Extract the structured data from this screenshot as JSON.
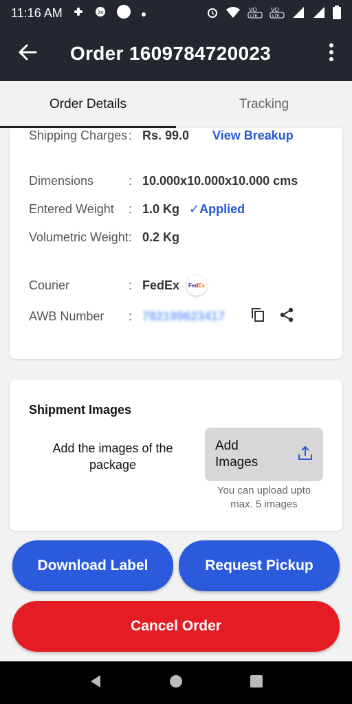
{
  "status_bar": {
    "time": "11:16 AM",
    "icons": [
      "slack-icon",
      "jio-icon",
      "circle-icon",
      "dot-icon",
      "alarm-icon",
      "wifi-icon",
      "volte-1-icon",
      "volte-2-icon",
      "signal-1-icon",
      "signal-2-icon",
      "battery-icon"
    ]
  },
  "app_bar": {
    "title": "Order 1609784720023",
    "back_icon": "arrow-back-icon",
    "menu_icon": "more-vert-icon"
  },
  "tabs": [
    {
      "label": "Order Details",
      "active": true
    },
    {
      "label": "Tracking",
      "active": false
    }
  ],
  "details": {
    "shipping_label": "Shipping Charges",
    "shipping_value": "Rs. 99.0",
    "view_breakup": "View Breakup",
    "dimensions_label": "Dimensions",
    "dimensions_value": "10.000x10.000x10.000 cms",
    "entered_weight_label": "Entered Weight",
    "entered_weight_value": "1.0 Kg",
    "applied": "✓Applied",
    "volumetric_label": "Volumetric Weight",
    "volumetric_value": "0.2 Kg",
    "courier_label": "Courier",
    "courier_value": "FedEx",
    "courier_logo": "FedEx",
    "awb_label": "AWB Number",
    "awb_value": "782199623417",
    "colon": ":"
  },
  "shipment_images": {
    "heading": "Shipment Images",
    "description": "Add the images of the package",
    "add_button": "Add Images",
    "note": "You can upload upto max. 5 images"
  },
  "actions": {
    "download_label": "Download Label",
    "request_pickup": "Request Pickup",
    "cancel_order": "Cancel Order"
  },
  "colors": {
    "app_bar": "#232730",
    "link_blue": "#2458d6",
    "button_blue": "#2b5bdc",
    "cancel_red": "#e41d25"
  }
}
